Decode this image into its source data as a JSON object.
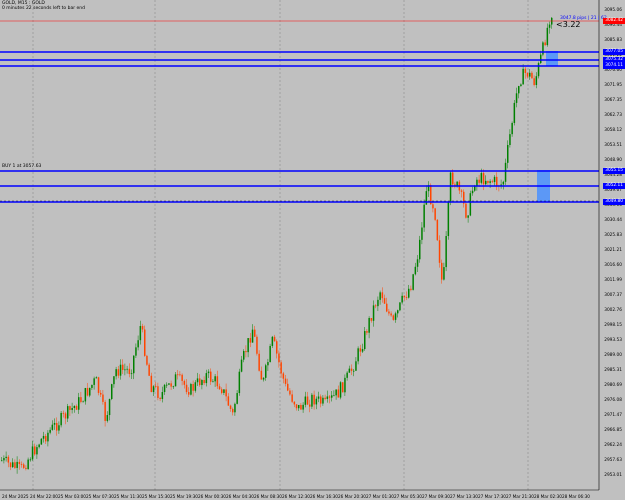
{
  "window": {
    "symbol_line": "GOLD, M15 : GOLD",
    "countdown": "0 minutes 22 seconds left to bar end"
  },
  "trade": {
    "label": "BUY 1 at 3057.63",
    "pips_label": "3047.8 pips | 21 | 63",
    "pl_value": "<3.22"
  },
  "axis": {
    "price_labels": [
      "3095.06",
      "3090.44",
      "3085.83",
      "3081.22",
      "3076.60",
      "3071.95",
      "3067.35",
      "3062.73",
      "3058.12",
      "3053.51",
      "3048.90",
      "3044.28",
      "3039.67",
      "3035.06",
      "3030.44",
      "3025.83",
      "3021.21",
      "3016.60",
      "3011.99",
      "3007.37",
      "3002.76",
      "2998.15",
      "2993.53",
      "2989.00",
      "2985.31",
      "2980.69",
      "2976.08",
      "2971.47",
      "2966.85",
      "2962.24",
      "2957.63",
      "2953.01"
    ],
    "time_labels": [
      "24 Mar 2025",
      "24 Mar 22:00",
      "25 Mar 03:00",
      "25 Mar 07:30",
      "25 Mar 11:30",
      "25 Mar 15:30",
      "25 Mar 19:30",
      "26 Mar 00:30",
      "26 Mar 04:30",
      "26 Mar 08:30",
      "26 Mar 12:30",
      "26 Mar 16:30",
      "26 Mar 20:30",
      "27 Mar 01:30",
      "27 Mar 05:30",
      "27 Mar 09:30",
      "27 Mar 13:30",
      "27 Mar 17:30",
      "27 Mar 21:30",
      "28 Mar 02:30",
      "28 Mar 06:30"
    ]
  },
  "levels": [
    {
      "name": "resistance-1",
      "label": "3077.05",
      "color": "#0000ff"
    },
    {
      "name": "resistance-2",
      "label": "3075.32",
      "color": "#0000ff"
    },
    {
      "name": "resistance-3",
      "label": "3074.11",
      "color": "#0000ff"
    },
    {
      "name": "support-1",
      "label": "3055.15",
      "color": "#0000ff"
    },
    {
      "name": "support-2",
      "label": "3052.11",
      "color": "#0000ff"
    },
    {
      "name": "support-3",
      "label": "3049.80",
      "color": "#0000ff"
    }
  ],
  "bid_label": "3082.42",
  "colors": {
    "bull": "#008000",
    "bear": "#ff4500",
    "level": "#0000ff",
    "zone": "#4a90ff",
    "bid": "#ff0000",
    "background": "#c0c0c0"
  }
}
